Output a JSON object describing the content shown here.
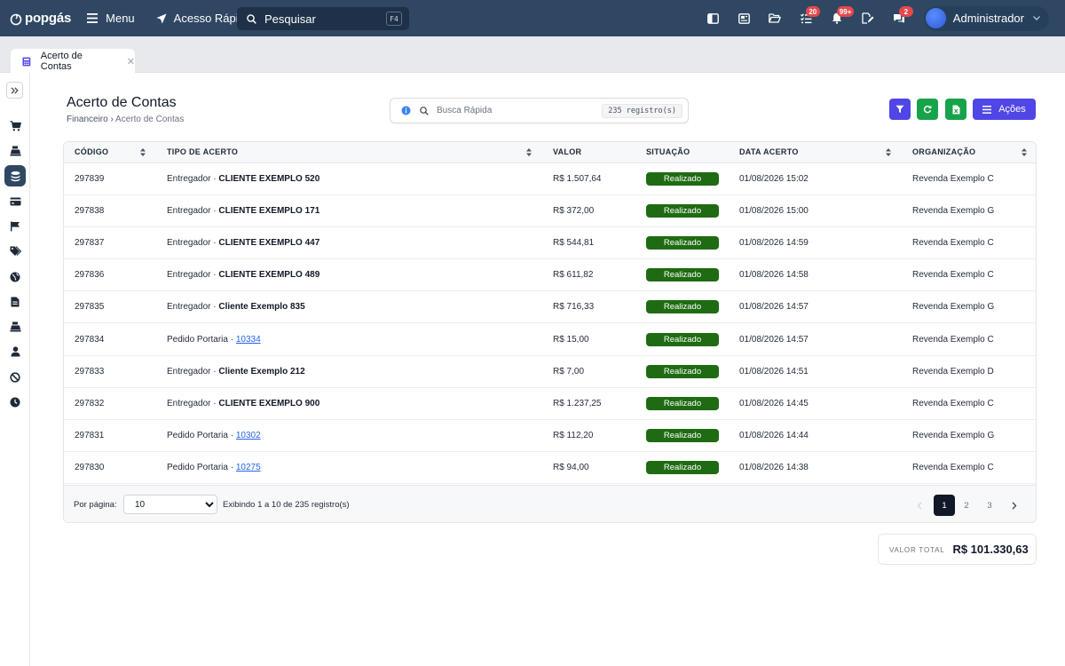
{
  "topbar": {
    "logo_text": "popgás",
    "menu_label": "Menu",
    "quick_access_label": "Acesso Rápido",
    "search_placeholder": "Pesquisar",
    "search_shortcut": "F4",
    "badges": {
      "tasks": "20",
      "notifications": "99+",
      "messages": "2"
    },
    "user_name": "Administrador"
  },
  "tabs": [
    {
      "label": "Acerto de Contas"
    }
  ],
  "page": {
    "title": "Acerto de Contas",
    "breadcrumb": [
      "Financeiro",
      "Acerto de Contas"
    ],
    "quick_search_placeholder": "Busca Rápida",
    "record_count": "235 registro(s)",
    "actions_label": "Ações"
  },
  "table": {
    "columns": [
      "CÓDIGO",
      "TIPO DE ACERTO",
      "VALOR",
      "SITUAÇÃO",
      "DATA ACERTO",
      "ORGANIZAÇÃO"
    ],
    "rows": [
      {
        "code": "297839",
        "type": "Entregador · ",
        "target": "CLIENTE EXEMPLO 520",
        "link": false,
        "value": "R$ 1.507,64",
        "status": "Realizado",
        "date": "01/08/2026 15:02",
        "org": "Revenda Exemplo C"
      },
      {
        "code": "297838",
        "type": "Entregador · ",
        "target": "CLIENTE EXEMPLO 171",
        "link": false,
        "value": "R$ 372,00",
        "status": "Realizado",
        "date": "01/08/2026 15:00",
        "org": "Revenda Exemplo G"
      },
      {
        "code": "297837",
        "type": "Entregador · ",
        "target": "CLIENTE EXEMPLO 447",
        "link": false,
        "value": "R$ 544,81",
        "status": "Realizado",
        "date": "01/08/2026 14:59",
        "org": "Revenda Exemplo C"
      },
      {
        "code": "297836",
        "type": "Entregador · ",
        "target": "CLIENTE EXEMPLO 489",
        "link": false,
        "value": "R$ 611,82",
        "status": "Realizado",
        "date": "01/08/2026 14:58",
        "org": "Revenda Exemplo C"
      },
      {
        "code": "297835",
        "type": "Entregador · ",
        "target": "Cliente Exemplo 835",
        "link": false,
        "value": "R$ 716,33",
        "status": "Realizado",
        "date": "01/08/2026 14:57",
        "org": "Revenda Exemplo G"
      },
      {
        "code": "297834",
        "type": "Pedido Portaria · ",
        "target": "10334",
        "link": true,
        "value": "R$ 15,00",
        "status": "Realizado",
        "date": "01/08/2026 14:57",
        "org": "Revenda Exemplo C"
      },
      {
        "code": "297833",
        "type": "Entregador · ",
        "target": "Cliente Exemplo 212",
        "link": false,
        "value": "R$ 7,00",
        "status": "Realizado",
        "date": "01/08/2026 14:51",
        "org": "Revenda Exemplo D"
      },
      {
        "code": "297832",
        "type": "Entregador · ",
        "target": "CLIENTE EXEMPLO 900",
        "link": false,
        "value": "R$ 1.237,25",
        "status": "Realizado",
        "date": "01/08/2026 14:45",
        "org": "Revenda Exemplo C"
      },
      {
        "code": "297831",
        "type": "Pedido Portaria · ",
        "target": "10302",
        "link": true,
        "value": "R$ 112,20",
        "status": "Realizado",
        "date": "01/08/2026 14:44",
        "org": "Revenda Exemplo G"
      },
      {
        "code": "297830",
        "type": "Pedido Portaria · ",
        "target": "10275",
        "link": true,
        "value": "R$ 94,00",
        "status": "Realizado",
        "date": "01/08/2026 14:38",
        "org": "Revenda Exemplo C"
      }
    ]
  },
  "footer": {
    "per_page_label": "Por página:",
    "per_page_value": "10",
    "showing_text": "Exibindo 1 a 10 de 235 registro(s)",
    "pages": [
      "1",
      "2",
      "3"
    ],
    "current_page": "1"
  },
  "total": {
    "label": "VALOR TOTAL",
    "value": "R$ 101.330,63"
  },
  "colors": {
    "topbar": "#2f4763",
    "primary": "#4f46e5",
    "success": "#1e6b12",
    "green_button": "#16a34a",
    "badge": "#e5484d"
  },
  "sidebar_icons": [
    "cart-icon",
    "cash-register-icon",
    "coins-icon",
    "credit-card-icon",
    "flag-icon",
    "tags-icon",
    "globe-icon",
    "document-icon",
    "register-icon",
    "user-icon",
    "ban-icon",
    "clock-icon"
  ]
}
